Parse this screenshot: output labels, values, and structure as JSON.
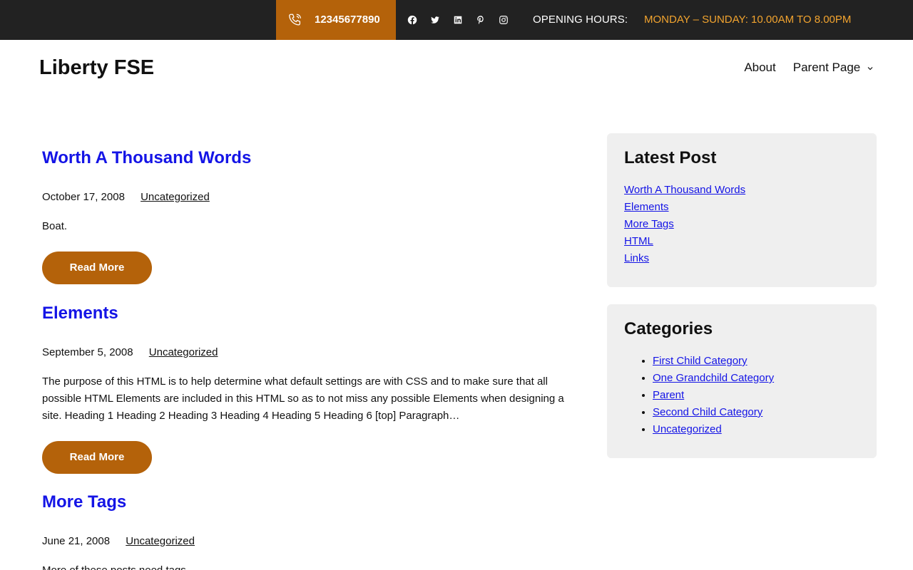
{
  "topbar": {
    "phone": "12345677890",
    "social_icons": [
      "facebook-icon",
      "twitter-icon",
      "linkedin-icon",
      "pinterest-icon",
      "instagram-icon"
    ],
    "hours_label": "OPENING HOURS:",
    "hours_value": "MONDAY – SUNDAY: 10.00AM TO 8.00PM"
  },
  "header": {
    "site_title": "Liberty FSE",
    "nav": {
      "about": "About",
      "parent_page": "Parent Page"
    }
  },
  "posts": [
    {
      "title": "Worth A Thousand Words",
      "date": "October 17, 2008",
      "category": "Uncategorized",
      "excerpt": "Boat.",
      "read_more": "Read More"
    },
    {
      "title": "Elements",
      "date": "September 5, 2008",
      "category": "Uncategorized",
      "excerpt": "The purpose of this HTML is to help determine what default settings are with CSS and to make sure that all possible HTML Elements are included in this HTML so as to not miss any possible Elements when designing a site. Heading 1 Heading 2 Heading 3 Heading 4 Heading 5 Heading 6 [top] Paragraph…",
      "read_more": "Read More"
    },
    {
      "title": "More Tags",
      "date": "June 21, 2008",
      "category": "Uncategorized",
      "excerpt": "More of these posts need tags."
    }
  ],
  "sidebar": {
    "latest": {
      "title": "Latest Post",
      "items": [
        "Worth A Thousand Words",
        "Elements",
        "More Tags",
        "HTML",
        "Links"
      ]
    },
    "categories": {
      "title": "Categories",
      "items": [
        "First Child Category",
        "One Grandchild Category",
        "Parent",
        "Second Child Category",
        "Uncategorized"
      ]
    }
  },
  "colors": {
    "accent": "#b4620a",
    "topbar_bg": "#222222",
    "hours_highlight": "#f2a42f",
    "link": "#1414e6",
    "widget_bg": "#efefef"
  }
}
